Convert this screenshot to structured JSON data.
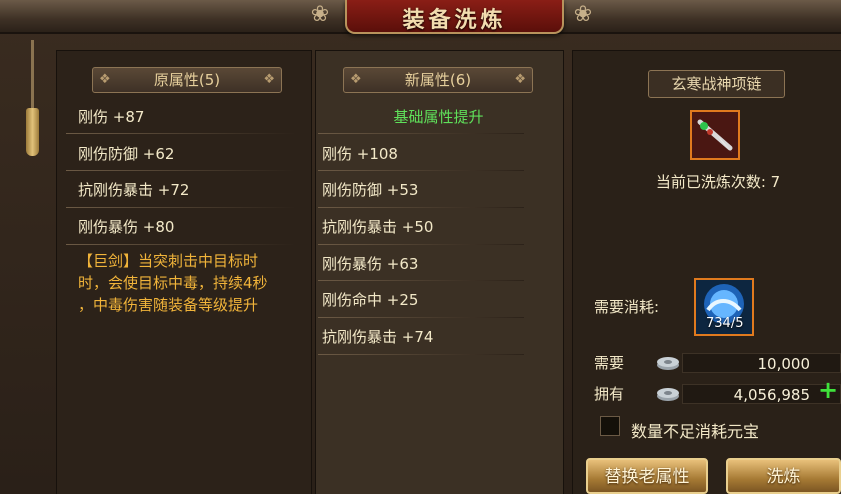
{
  "window": {
    "title": "装备洗炼"
  },
  "original": {
    "header": "原属性(5)",
    "attributes": [
      {
        "text": "刚伤 +87"
      },
      {
        "text": "刚伤防御 +62"
      },
      {
        "text": "抗刚伤暴击 +72"
      },
      {
        "text": "刚伤暴伤 +80"
      }
    ],
    "description_lines": [
      "【巨剑】当突刺击中目标时",
      "时，会使目标中毒，持续4秒",
      "，中毒伤害随装备等级提升"
    ]
  },
  "new": {
    "header": "新属性(6)",
    "status": "基础属性提升",
    "attributes": [
      {
        "text": "刚伤 +108"
      },
      {
        "text": "刚伤防御 +53"
      },
      {
        "text": "抗刚伤暴击 +50"
      },
      {
        "text": "刚伤暴伤 +63"
      },
      {
        "text": "刚伤命中 +25"
      },
      {
        "text": "抗刚伤暴击 +74"
      }
    ]
  },
  "item": {
    "name": "玄寒战神项链",
    "refine_count_label": "当前已洗炼次数: 7",
    "icon": "necklace-icon"
  },
  "cost": {
    "label": "需要消耗:",
    "material_icon": "refine-stone-icon",
    "material_count": "734/5"
  },
  "currency": {
    "icon": "coin-icon",
    "need_label": "需要",
    "need_value": "10,000",
    "have_label": "拥有",
    "have_value": "4,056,985"
  },
  "options": {
    "checkbox_label": "数量不足消耗元宝"
  },
  "buttons": {
    "replace_label": "替换老属性",
    "refine_label": "洗炼"
  },
  "colors": {
    "accent_gold": "#e6cf9c",
    "new_positive_green": "#5fe05a",
    "description_orange": "#f1b43a",
    "item_border": "#e07a1e"
  }
}
